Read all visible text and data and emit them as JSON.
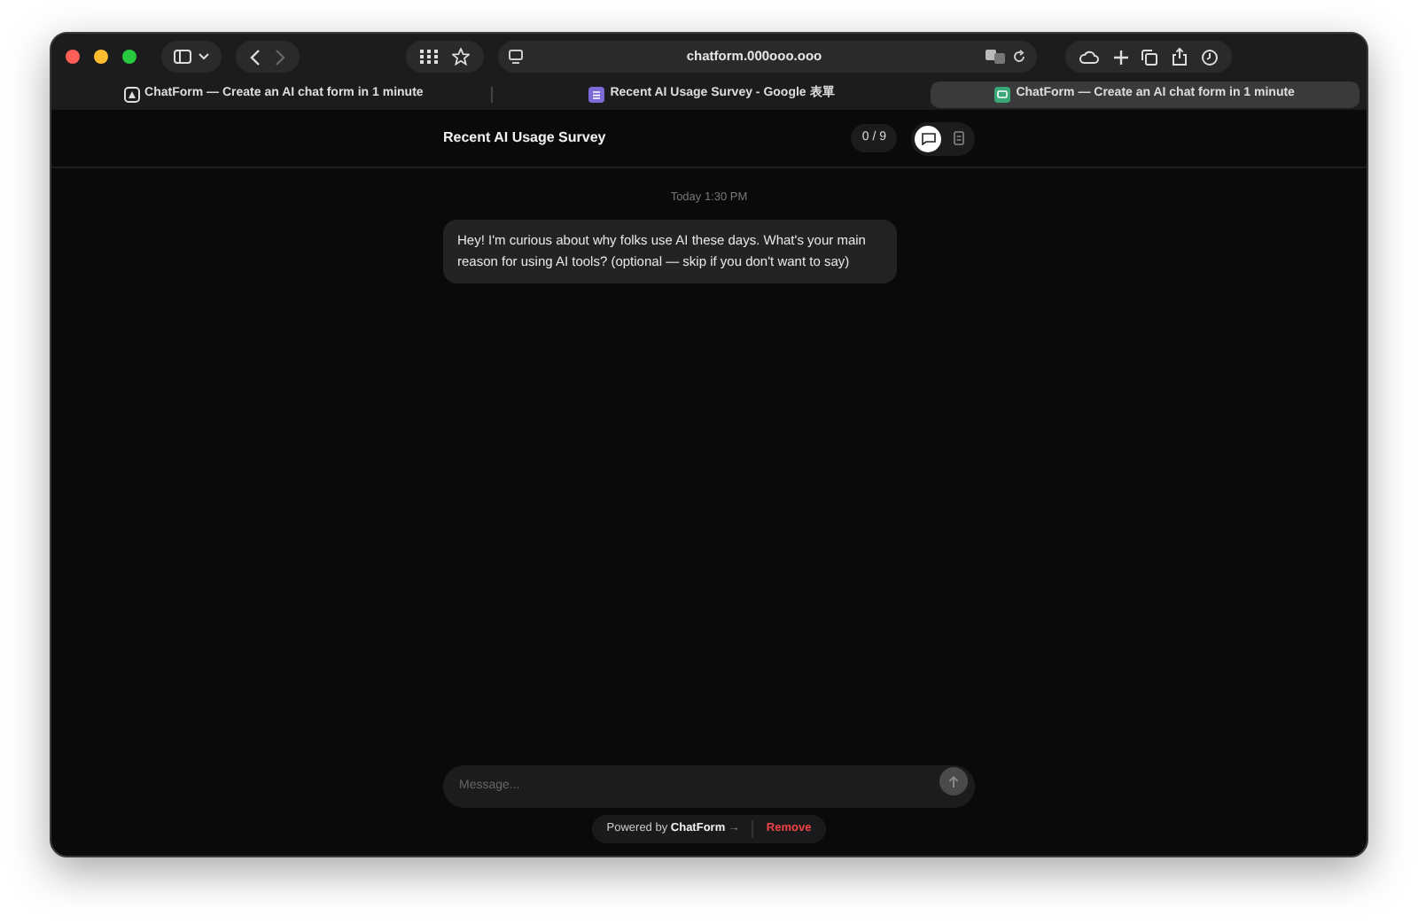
{
  "browser": {
    "address": "chatform.000ooo.ooo"
  },
  "tabs": [
    {
      "title": "ChatForm — Create an AI chat form in 1 minute",
      "kind": "chatform",
      "selected": false
    },
    {
      "title": "Recent AI Usage Survey - Google 表單",
      "kind": "forms",
      "selected": false
    },
    {
      "title": "ChatForm — Create an AI chat form in 1 minute",
      "kind": "chatform-green",
      "selected": true
    }
  ],
  "header": {
    "title": "Recent AI Usage Survey",
    "progress": "0 / 9",
    "view_modes": [
      {
        "kind": "chat",
        "selected": true
      },
      {
        "kind": "document",
        "selected": false
      }
    ]
  },
  "messages": [
    {
      "timestamp": "Today 1:30 PM",
      "text": "Hey! I'm curious about why folks use AI these days. What's your main reason for using AI tools? (optional — skip if you don't want to say)"
    }
  ],
  "composer": {
    "placeholder": "Message..."
  },
  "footer": {
    "powered_by": "Powered by",
    "brand": "ChatForm",
    "arrow": "→",
    "remove": "Remove"
  }
}
